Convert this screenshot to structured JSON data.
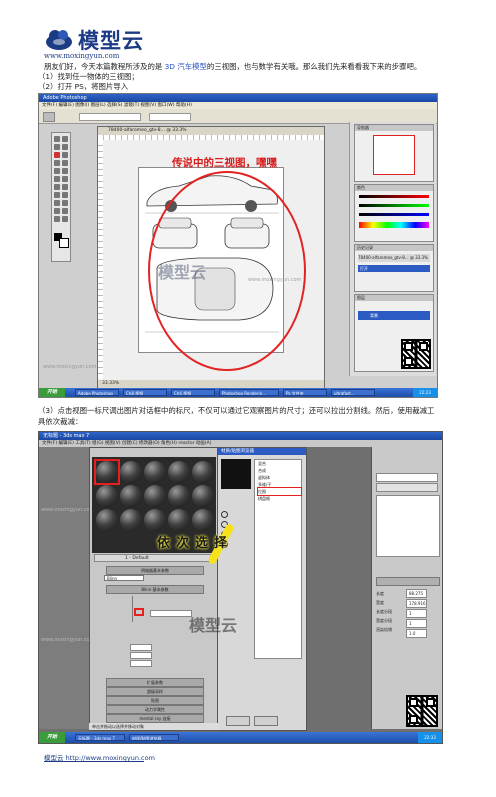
{
  "header": {
    "logo_text": "模型云",
    "logo_url": "www.moxingyun.com"
  },
  "intro": {
    "line1_a": "朋友们好，今天本篇教程所涉及的是 ",
    "line1_highlight": "3D 汽车模型",
    "line1_b": "的三视图，也与数学有关哦。那么我们先来看看我下来的步骤吧。",
    "step1": "（1）找到任一物体的三视图；",
    "step2": "（2）打开 PS，将图片导入"
  },
  "photoshop": {
    "window_title": "Adobe Photoshop",
    "menu": "文件(F)  编辑(E)  图像(I)  图层(L)  选择(S)  滤镜(T)  视图(V)  窗口(W)  帮助(H)",
    "doc_title": "78400-alfaromeo_gtv-8... @ 33.3%",
    "status": "33.33%",
    "annotation": "传说中的三视图，嘿嘿",
    "panel_navigator": "导航器",
    "panel_color": "颜色",
    "panel_history": "历史记录",
    "panel_layers": "图层",
    "history_item": "打开",
    "layer_item": "背景",
    "taskbar_start": "开始",
    "taskbar_items": [
      "Adobe Photoshop",
      "Ch8 视频",
      "Ch6 视频",
      "Photoshop Renderin...",
      "Ps 文件夹",
      "ultrafast..."
    ],
    "clock": "22:23"
  },
  "step3": {
    "line1": "（3）点击视图一标尺调出图片对话框中的标尺，不仅可以通过它观察图片的尺寸；还可以拉出分割线。然后，使用裁减工",
    "line2": "具依次裁减："
  },
  "max": {
    "window_title": "无标题 - 3ds max 7",
    "menu": "文件(F)  编辑(E)  工具(T)  组(G)  视图(V)  创建(C)  修改器(O)  角色(H)  reactor  动画(A)",
    "browser_title": "材质/贴图浏览器",
    "browser_items": [
      "混合",
      "合成",
      "虚拟体",
      "多维/子",
      "位图",
      "棋盘格"
    ],
    "rollouts": [
      "明暗器基本参数",
      "Blinn 基本参数",
      "扩展参数",
      "超级采样",
      "贴图",
      "动力学属性",
      "mental ray 连接"
    ],
    "material_name": "1 - Default",
    "shader": "Blinn",
    "annotation": "依次选择",
    "right_fields": [
      "长度",
      "宽度",
      "长度分段",
      "宽度分段",
      "渲染倍增"
    ],
    "right_values": [
      "88.275",
      "178.916",
      "1",
      "1",
      "1.0"
    ],
    "status": "单击并拖动以选择并移动对象",
    "clock": "22:33"
  },
  "watermark": {
    "brand": "模型云",
    "url": "www.moxingyun.com"
  },
  "footer": {
    "text": "模型云 http://www.moxingyun.com"
  },
  "colors": {
    "brand": "#1b3b84",
    "highlight": "#2a56c6",
    "annotation_red": "#d81b1b",
    "annotation_yellow": "#f5e21a"
  }
}
